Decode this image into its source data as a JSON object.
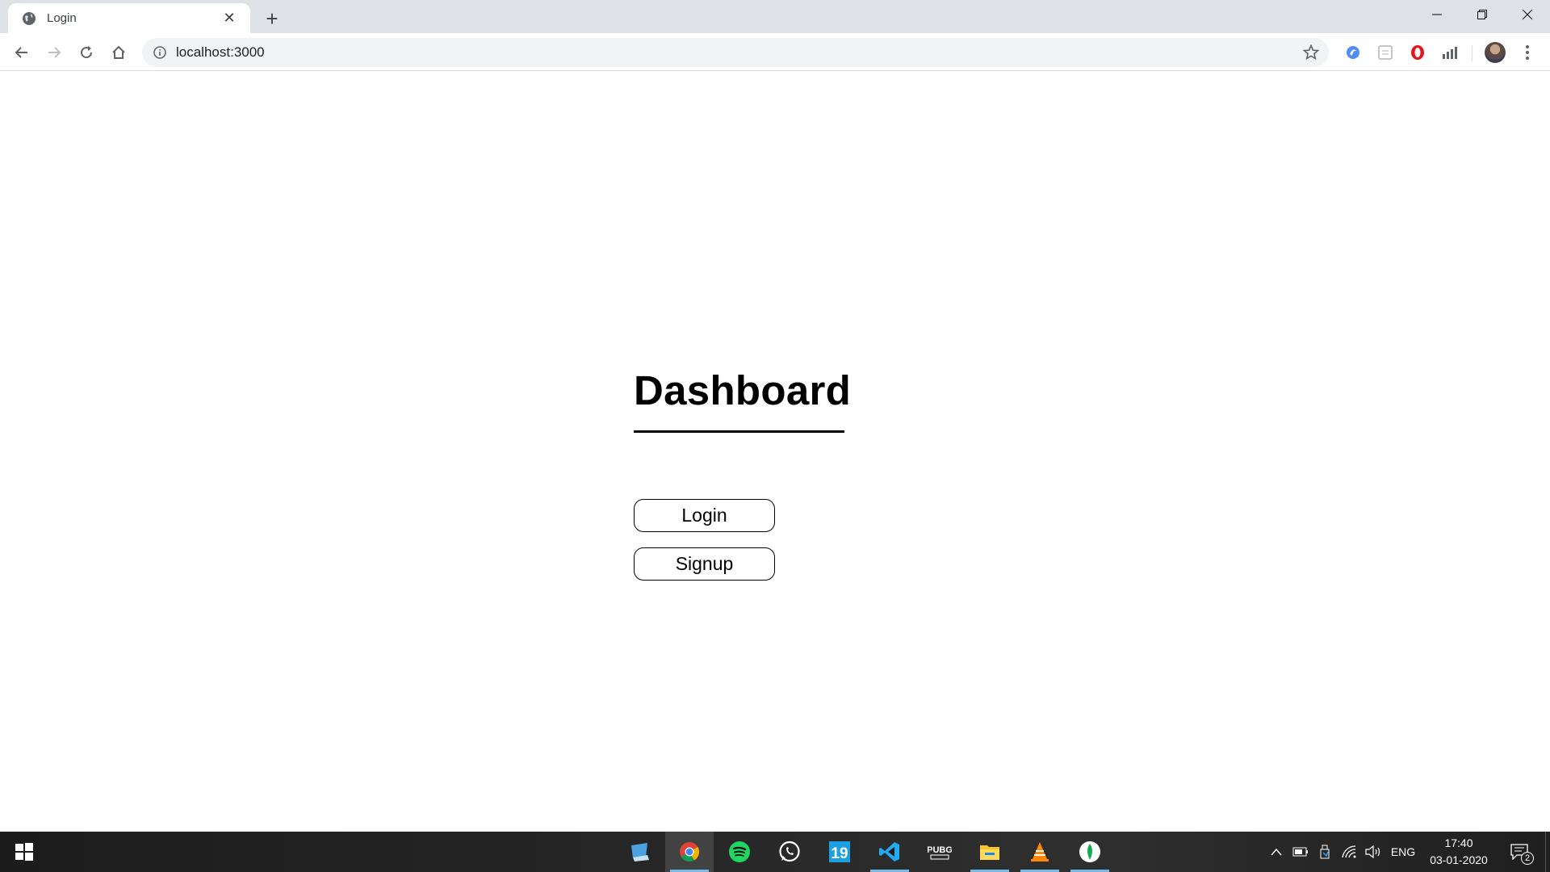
{
  "browser": {
    "tab": {
      "title": "Login",
      "favicon": "globe-icon",
      "close": "✕"
    },
    "new_tab": "+",
    "address": {
      "url": "localhost:3000",
      "info_icon": "info-icon"
    },
    "window_controls": [
      "minimize-icon",
      "restore-icon",
      "close-icon"
    ],
    "extensions": [
      "edge-like-icon",
      "reader-icon",
      "opera-icon",
      "stats-icon"
    ]
  },
  "page": {
    "title": "Dashboard",
    "buttons": {
      "login_label": "Login",
      "signup_label": "Signup"
    }
  },
  "taskbar": {
    "apps": [
      {
        "name": "desktop-icon",
        "active": false
      },
      {
        "name": "chrome-icon",
        "active": true
      },
      {
        "name": "spotify-icon",
        "active": false
      },
      {
        "name": "whatsapp-icon",
        "active": false
      },
      {
        "name": "nineteen-app-icon",
        "label": "19",
        "active": false
      },
      {
        "name": "vscode-icon",
        "active": false
      },
      {
        "name": "pubg-icon",
        "label": "PUBG",
        "active": false
      },
      {
        "name": "file-explorer-icon",
        "active": false
      },
      {
        "name": "vlc-icon",
        "active": false
      },
      {
        "name": "mongodb-icon",
        "active": false
      }
    ],
    "tray": {
      "language": "ENG",
      "time": "17:40",
      "date": "03-01-2020",
      "notifications": "2"
    }
  },
  "colors": {
    "tabstrip": "#dee1e6",
    "omnibox": "#f1f3f4",
    "active_indicator": "#76b9ed"
  }
}
